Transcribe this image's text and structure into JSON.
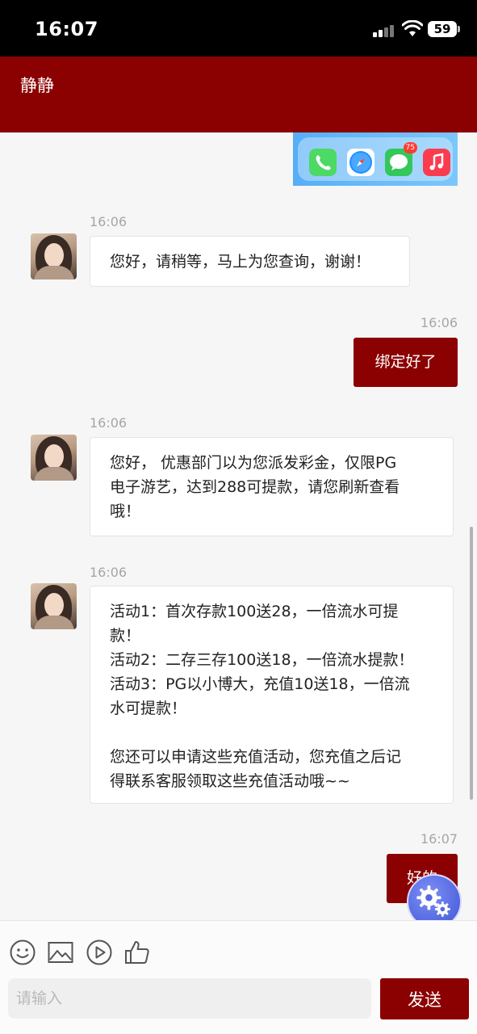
{
  "status_bar": {
    "time": "16:07",
    "battery": "59"
  },
  "header": {
    "title": "静静"
  },
  "dock": {
    "messages_badge": "75",
    "apps": [
      "phone-icon",
      "safari-icon",
      "messages-icon",
      "music-icon"
    ]
  },
  "messages": [
    {
      "side": "in",
      "time": "16:06",
      "text": "您好，请稍等，马上为您查询，谢谢！"
    },
    {
      "side": "out",
      "time": "16:06",
      "text": "绑定好了"
    },
    {
      "side": "in",
      "time": "16:06",
      "text": "您好， 优惠部门以为您派发彩金，仅限PG\n电子游艺，达到288可提款，请您刷新查看\n哦！"
    },
    {
      "side": "in",
      "time": "16:06",
      "text": "活动1：首次存款100送28，一倍流水可提\n款！\n活动2：二存三存100送18，一倍流水提款！\n活动3：PG以小博大，充值10送18，一倍流\n水可提款！\n\n您还可以申请这些充值活动，您充值之后记\n得联系客服领取这些充值活动哦~~"
    },
    {
      "side": "out",
      "time": "16:07",
      "text": "好的"
    }
  ],
  "composer": {
    "placeholder": "请输入",
    "send_label": "发送",
    "tools": [
      "emoji-icon",
      "image-icon",
      "video-icon",
      "thumbs-up-icon"
    ]
  },
  "colors": {
    "brand": "#8b0000",
    "background": "#f6f6f6"
  }
}
